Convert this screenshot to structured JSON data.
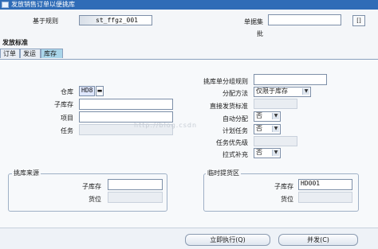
{
  "window": {
    "title": "发放销售订单以便挑库"
  },
  "header": {
    "base_rule_label": "基于规则",
    "base_rule_value": "st_ffgz_001",
    "order_set_label": "单据集",
    "batch_label": "批",
    "bracket_btn_label": "[]"
  },
  "criteria": {
    "title": "发放标准",
    "tabs": [
      "订单",
      "发运",
      "库存"
    ]
  },
  "inventory": {
    "warehouse_label": "仓库",
    "warehouse_value": "HD8",
    "subinventory_label": "子库存",
    "item_label": "项目",
    "task_label": "任务",
    "pick_group_rule_label": "挑库单分组规则",
    "allocation_label": "分配方法",
    "allocation_value": "仅限于库存",
    "direct_ship_label": "直接发货标准",
    "auto_allocate_label": "自动分配",
    "auto_allocate_value": "否",
    "plan_task_label": "计划任务",
    "plan_task_value": "否",
    "task_priority_label": "任务优先级",
    "pull_replenish_label": "拉式补充",
    "pull_replenish_value": "否"
  },
  "pick_source": {
    "title": "挑库来源",
    "subinventory_label": "子库存",
    "locator_label": "货位"
  },
  "staging": {
    "title": "临时提货区",
    "subinventory_label": "子库存",
    "subinventory_value": "HD001",
    "locator_label": "货位"
  },
  "buttons": {
    "execute_now": "立即执行(Q)",
    "release": "并发(C)"
  },
  "watermark": {
    "text": "http://blog.csdn"
  },
  "colors": {
    "titlebar": "#2f6cb7",
    "active_tab": "#a9d5ea",
    "focus_field": "#dfe7ff"
  }
}
